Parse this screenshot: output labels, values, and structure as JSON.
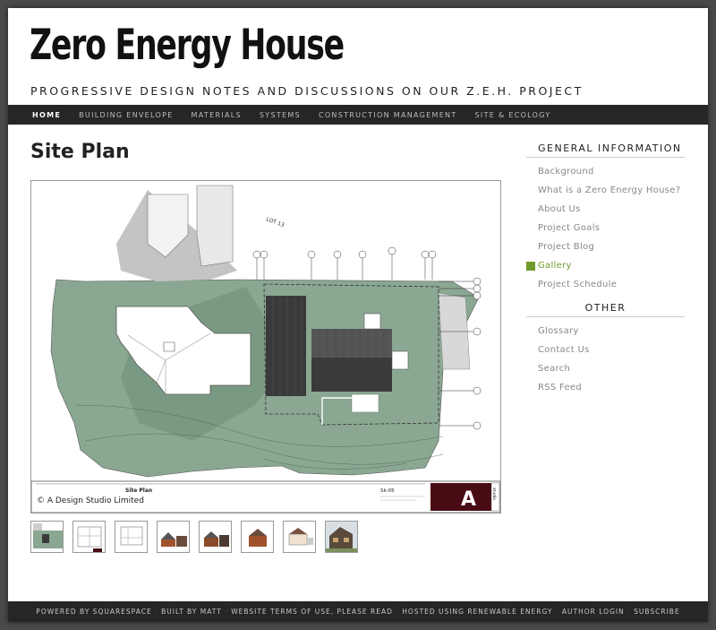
{
  "site": {
    "title": "Zero Energy House",
    "tagline": "PROGRESSIVE DESIGN NOTES AND DISCUSSIONS ON OUR Z.E.H. PROJECT"
  },
  "nav": {
    "items": [
      {
        "label": "HOME",
        "active": true
      },
      {
        "label": "BUILDING ENVELOPE",
        "active": false
      },
      {
        "label": "MATERIALS",
        "active": false
      },
      {
        "label": "SYSTEMS",
        "active": false
      },
      {
        "label": "CONSTRUCTION MANAGEMENT",
        "active": false
      },
      {
        "label": "SITE & ECOLOGY",
        "active": false
      }
    ]
  },
  "main": {
    "heading": "Site Plan",
    "drawing": {
      "caption_title": "Site Plan",
      "copyright": "© A Design Studio Limited",
      "sheet_number": "Sk-05",
      "logo_letter": "A",
      "logo_word": "studio",
      "grid_letters": [
        "A",
        "B",
        "D",
        "E",
        "I",
        "F",
        "G",
        "H"
      ],
      "grid_numbers": [
        "6",
        "5",
        "4",
        "3",
        "2",
        "1"
      ],
      "lot_label": "LOT 13",
      "colors": {
        "site_green": "#8aa792",
        "dark_green": "#6f8f78",
        "roof_dark": "#3a3a3a",
        "logo_bg": "#4a0c14"
      }
    },
    "thumbnails": [
      {
        "name": "site-plan"
      },
      {
        "name": "floor-plan-1"
      },
      {
        "name": "floor-plan-2"
      },
      {
        "name": "elevation-1"
      },
      {
        "name": "elevation-2"
      },
      {
        "name": "elevation-3"
      },
      {
        "name": "section"
      },
      {
        "name": "render"
      }
    ]
  },
  "sidebar": {
    "general_heading": "GENERAL INFORMATION",
    "general_links": [
      {
        "label": "Background",
        "active": false
      },
      {
        "label": "What is a Zero Energy House?",
        "active": false
      },
      {
        "label": "About Us",
        "active": false
      },
      {
        "label": "Project Goals",
        "active": false
      },
      {
        "label": "Project Blog",
        "active": false
      },
      {
        "label": "Gallery",
        "active": true
      },
      {
        "label": "Project Schedule",
        "active": false
      }
    ],
    "other_heading": "OTHER",
    "other_links": [
      {
        "label": "Glossary"
      },
      {
        "label": "Contact Us"
      },
      {
        "label": "Search"
      },
      {
        "label": "RSS Feed"
      }
    ],
    "accent_color": "#6f9a2a"
  },
  "footer": {
    "items": [
      "POWERED BY SQUARESPACE",
      "BUILT BY MATT",
      "WEBSITE TERMS OF USE, PLEASE READ",
      "HOSTED USING RENEWABLE ENERGY",
      "AUTHOR LOGIN",
      "SUBSCRIBE"
    ]
  }
}
